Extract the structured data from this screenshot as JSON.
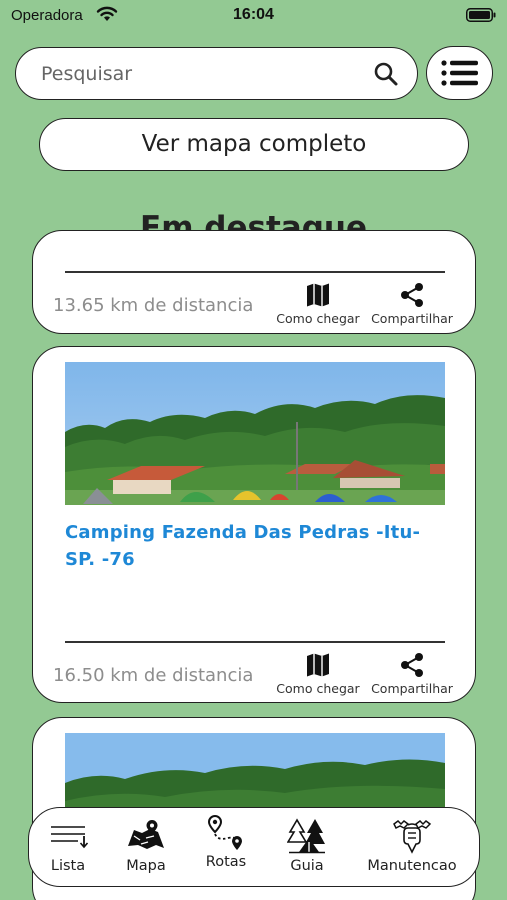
{
  "status": {
    "carrier": "Operadora",
    "time": "16:04"
  },
  "search": {
    "placeholder": "Pesquisar",
    "icon": "search-icon"
  },
  "menu_button": {
    "icon": "list-menu-icon"
  },
  "map_button_label": "Ver mapa completo",
  "section_title": "Em destaque",
  "cards": [
    {
      "title": "",
      "distance": "13.65 km de distancia",
      "directions_label": "Como chegar",
      "share_label": "Compartilhar"
    },
    {
      "title": "Camping Fazenda Das Pedras -Itu-SP. -76",
      "distance": "16.50 km de distancia",
      "directions_label": "Como chegar",
      "share_label": "Compartilhar"
    },
    {
      "title": "",
      "distance": "",
      "directions_label": "",
      "share_label": ""
    }
  ],
  "tabs": [
    {
      "label": "Lista",
      "icon": "list-icon"
    },
    {
      "label": "Mapa",
      "icon": "map-icon"
    },
    {
      "label": "Rotas",
      "icon": "route-icon"
    },
    {
      "label": "Guia",
      "icon": "forest-tent-icon"
    },
    {
      "label": "Manutencao",
      "icon": "tools-icon"
    }
  ],
  "colors": {
    "background": "#93c993",
    "card": "#ffffff",
    "title_link": "#1e88d6",
    "distance_text": "#8d8d8d"
  }
}
